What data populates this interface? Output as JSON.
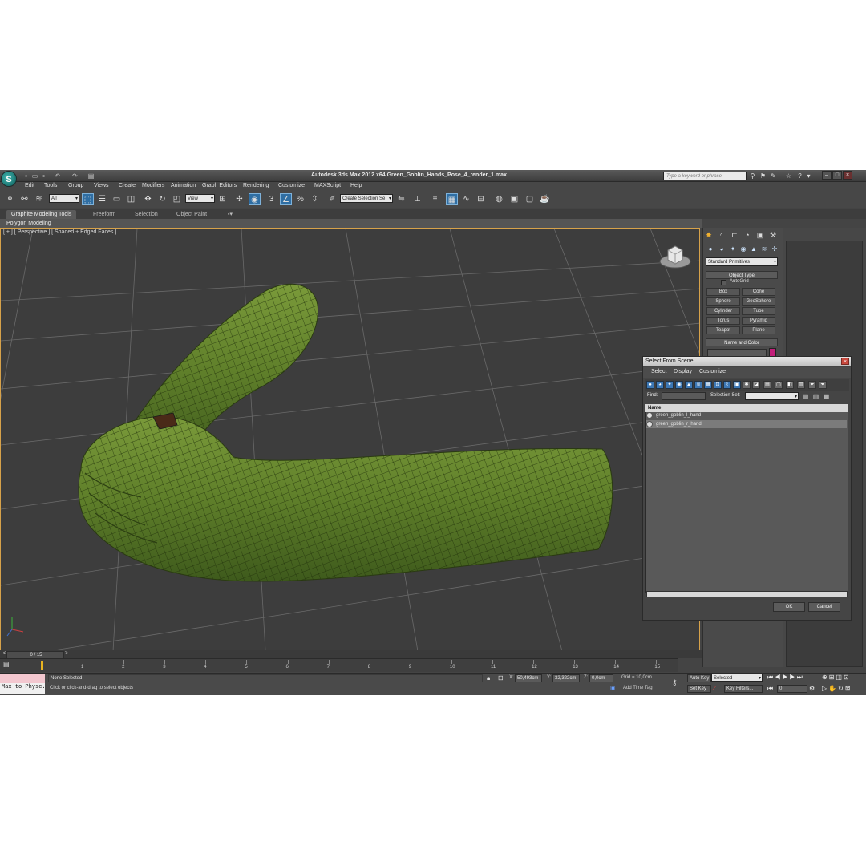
{
  "app": {
    "title": "Autodesk 3ds Max  2012 x64     Green_Goblin_Hands_Pose_4_render_1.max",
    "logo": "3ds-max-logo",
    "search_placeholder": "Type a keyword or phrase"
  },
  "menu": [
    "Edit",
    "Tools",
    "Group",
    "Views",
    "Create",
    "Modifiers",
    "Animation",
    "Graph Editors",
    "Rendering",
    "Customize",
    "MAXScript",
    "Help"
  ],
  "toolbar": {
    "selection_filter": "All",
    "ref_coord": "View",
    "named_selection": "Create Selection Se"
  },
  "ribbon": {
    "tabs": [
      "Graphite Modeling Tools",
      "Freeform",
      "Selection",
      "Object Paint"
    ],
    "active_tab": 0,
    "sub_label": "Polygon Modeling"
  },
  "viewport": {
    "label": "[ + ] [ Perspective ] [ Shaded + Edged Faces ]"
  },
  "command_panel": {
    "category": "Standard Primitives",
    "object_type_header": "Object Type",
    "autogrid": "AutoGrid",
    "buttons": [
      "Box",
      "Cone",
      "Sphere",
      "GeoSphere",
      "Cylinder",
      "Tube",
      "Torus",
      "Pyramid",
      "Teapot",
      "Plane"
    ],
    "name_color_header": "Name and Color",
    "object_color": "#c21f7a"
  },
  "dialog": {
    "title": "Select From Scene",
    "menus": [
      "Select",
      "Display",
      "Customize"
    ],
    "find_label": "Find:",
    "selection_set_label": "Selection Set:",
    "column_header": "Name",
    "items": [
      "green_goblin_l_hand",
      "green_goblin_r_hand"
    ],
    "selected_index": 1,
    "ok": "OK",
    "cancel": "Cancel"
  },
  "timeline": {
    "frame_counter": "0 / 15",
    "ticks": [
      "1",
      "2",
      "3",
      "4",
      "5",
      "6",
      "7",
      "8",
      "9",
      "10",
      "11",
      "12",
      "13",
      "14",
      "15"
    ]
  },
  "status": {
    "maxscript": "Max to Physc.",
    "selection": "None Selected",
    "prompt": "Click or click-and-drag to select objects",
    "x_label": "X:",
    "x_value": "50,493cm",
    "y_label": "Y:",
    "y_value": "32,322cm",
    "z_label": "Z:",
    "z_value": "0,0cm",
    "grid": "Grid = 10,0cm",
    "add_time_tag": "Add Time Tag",
    "auto_key": "Auto Key",
    "set_key": "Set Key",
    "key_mode": "Selected",
    "key_filters": "Key Filters...",
    "current_frame": "0"
  }
}
